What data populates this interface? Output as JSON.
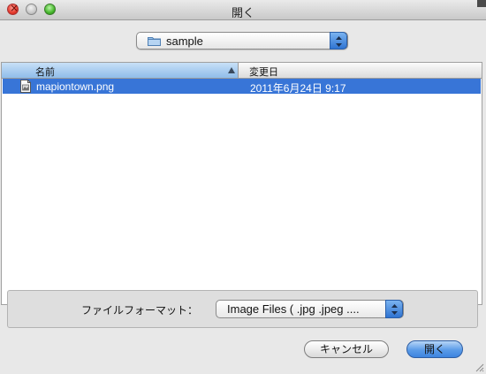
{
  "window": {
    "title": "開く"
  },
  "location": {
    "folder_name": "sample",
    "icon": "folder-icon"
  },
  "file_list": {
    "columns": {
      "name": "名前",
      "date_modified": "変更日"
    },
    "sort": "name-ascending",
    "rows": [
      {
        "name": "mapiontown.png",
        "date_modified": "2011年6月24日 9:17",
        "selected": true,
        "icon": "image-file-icon"
      }
    ]
  },
  "format": {
    "label": "ファイルフォーマット：",
    "value": "Image Files ( .jpg .jpeg ...."
  },
  "buttons": {
    "cancel": "キャンセル",
    "open": "開く"
  },
  "colors": {
    "selection": "#3875d7",
    "default_button": "#5a9be8"
  }
}
